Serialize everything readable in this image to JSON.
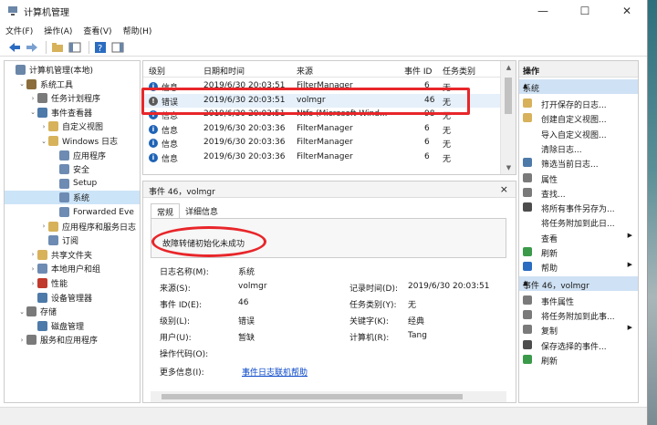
{
  "window": {
    "title": "计算机管理"
  },
  "menu": [
    "文件(F)",
    "操作(A)",
    "查看(V)",
    "帮助(H)"
  ],
  "tree": [
    {
      "label": "计算机管理(本地)",
      "indent": 0,
      "exp": "",
      "color": "#6a86a8"
    },
    {
      "label": "系统工具",
      "indent": 1,
      "exp": "v",
      "color": "#8a6d3b"
    },
    {
      "label": "任务计划程序",
      "indent": 2,
      "exp": ">",
      "color": "#7a7a7a"
    },
    {
      "label": "事件查看器",
      "indent": 2,
      "exp": "v",
      "color": "#4d7aa8"
    },
    {
      "label": "自定义视图",
      "indent": 3,
      "exp": ">",
      "color": "#d7b25b"
    },
    {
      "label": "Windows 日志",
      "indent": 3,
      "exp": "v",
      "color": "#d7b25b"
    },
    {
      "label": "应用程序",
      "indent": 4,
      "exp": "",
      "color": "#6d8bb3"
    },
    {
      "label": "安全",
      "indent": 4,
      "exp": "",
      "color": "#6d8bb3"
    },
    {
      "label": "Setup",
      "indent": 4,
      "exp": "",
      "color": "#6d8bb3"
    },
    {
      "label": "系统",
      "indent": 4,
      "exp": "",
      "color": "#6d8bb3",
      "sel": true
    },
    {
      "label": "Forwarded Eve",
      "indent": 4,
      "exp": "",
      "color": "#6d8bb3"
    },
    {
      "label": "应用程序和服务日志",
      "indent": 3,
      "exp": ">",
      "color": "#d7b25b"
    },
    {
      "label": "订阅",
      "indent": 3,
      "exp": "",
      "color": "#6d8bb3"
    },
    {
      "label": "共享文件夹",
      "indent": 2,
      "exp": ">",
      "color": "#d7b25b"
    },
    {
      "label": "本地用户和组",
      "indent": 2,
      "exp": ">",
      "color": "#6d8bb3"
    },
    {
      "label": "性能",
      "indent": 2,
      "exp": ">",
      "color": "#c0392b"
    },
    {
      "label": "设备管理器",
      "indent": 2,
      "exp": "",
      "color": "#4d7aa8"
    },
    {
      "label": "存储",
      "indent": 1,
      "exp": "v",
      "color": "#7a7a7a"
    },
    {
      "label": "磁盘管理",
      "indent": 2,
      "exp": "",
      "color": "#4d7aa8"
    },
    {
      "label": "服务和应用程序",
      "indent": 1,
      "exp": ">",
      "color": "#7a7a7a"
    }
  ],
  "events": {
    "headers": [
      "级别",
      "日期和时间",
      "来源",
      "事件 ID",
      "任务类别"
    ],
    "rows": [
      {
        "level": "信息",
        "time": "2019/6/30 20:03:51",
        "source": "FilterManager",
        "id": "6",
        "cat": "无"
      },
      {
        "level": "错误",
        "time": "2019/6/30 20:03:51",
        "source": "volmgr",
        "id": "46",
        "cat": "无",
        "sel": true
      },
      {
        "level": "信息",
        "time": "2019/6/30 20:03:51",
        "source": "Ntfs (Microsoft-Wind...",
        "id": "98",
        "cat": "无"
      },
      {
        "level": "信息",
        "time": "2019/6/30 20:03:36",
        "source": "FilterManager",
        "id": "6",
        "cat": "无"
      },
      {
        "level": "信息",
        "time": "2019/6/30 20:03:36",
        "source": "FilterManager",
        "id": "6",
        "cat": "无"
      },
      {
        "level": "信息",
        "time": "2019/6/30 20:03:36",
        "source": "FilterManager",
        "id": "6",
        "cat": "无"
      }
    ]
  },
  "detail": {
    "header": "事件 46，volmgr",
    "close": "×",
    "tab_general": "常规",
    "tab_details": "详细信息",
    "description": "故障转储初始化未成功",
    "log_name_label": "日志名称(M):",
    "log_name": "系统",
    "source_label": "来源(S):",
    "source": "volmgr",
    "recorded_label": "记录时间(D):",
    "recorded": "2019/6/30 20:03:51",
    "event_id_label": "事件 ID(E):",
    "event_id": "46",
    "task_label": "任务类别(Y):",
    "task": "无",
    "level_label": "级别(L):",
    "level": "错误",
    "keywords_label": "关键字(K):",
    "keywords": "经典",
    "user_label": "用户(U):",
    "user": "暂缺",
    "computer_label": "计算机(R):",
    "computer": "Tang",
    "opcode_label": "操作代码(O):",
    "more_label": "更多信息(I):",
    "more_link": "事件日志联机帮助"
  },
  "actions": {
    "title": "操作",
    "section1": "系统",
    "items1": [
      {
        "label": "打开保存的日志...",
        "color": "#d7b25b",
        "sub": ""
      },
      {
        "label": "创建自定义视图...",
        "color": "#d7b25b",
        "sub": ""
      },
      {
        "label": "导入自定义视图...",
        "color": "#ffffff",
        "sub": ""
      },
      {
        "label": "清除日志...",
        "color": "#ffffff",
        "sub": ""
      },
      {
        "label": "筛选当前日志...",
        "color": "#4d7aa8",
        "sub": ""
      },
      {
        "label": "属性",
        "color": "#7a7a7a",
        "sub": ""
      },
      {
        "label": "查找...",
        "color": "#7a7a7a",
        "sub": ""
      },
      {
        "label": "将所有事件另存为...",
        "color": "#4d4d4d",
        "sub": ""
      },
      {
        "label": "将任务附加到此日...",
        "color": "#ffffff",
        "sub": ""
      },
      {
        "label": "查看",
        "color": "#ffffff",
        "sub": "▶"
      },
      {
        "label": "刷新",
        "color": "#3a9a4a",
        "sub": ""
      },
      {
        "label": "帮助",
        "color": "#2a6cc0",
        "sub": "▶"
      }
    ],
    "section2": "事件 46，volmgr",
    "items2": [
      {
        "label": "事件属性",
        "color": "#7a7a7a",
        "sub": ""
      },
      {
        "label": "将任务附加到此事...",
        "color": "#7a7a7a",
        "sub": ""
      },
      {
        "label": "复制",
        "color": "#7a7a7a",
        "sub": "▶"
      },
      {
        "label": "保存选择的事件...",
        "color": "#4d4d4d",
        "sub": ""
      },
      {
        "label": "刷新",
        "color": "#3a9a4a",
        "sub": ""
      }
    ]
  }
}
